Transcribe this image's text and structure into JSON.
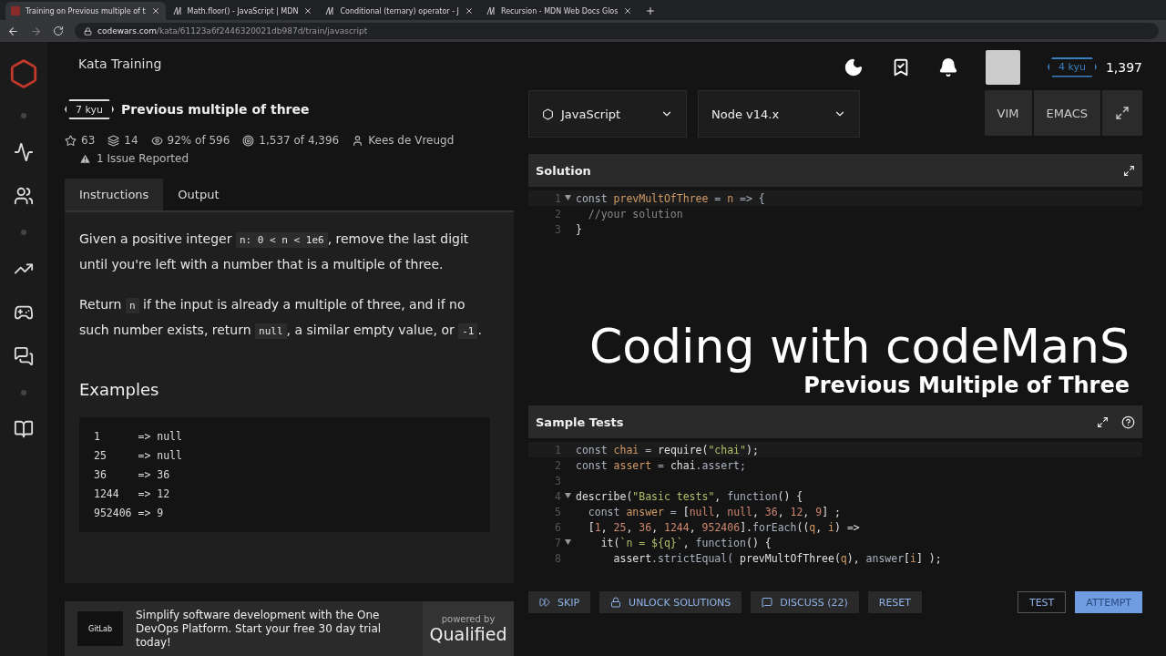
{
  "browser": {
    "tabs": [
      {
        "title": "Training on Previous multiple of t",
        "selected": true
      },
      {
        "title": "Math.floor() - JavaScript | MDN",
        "selected": false
      },
      {
        "title": "Conditional (ternary) operator - J",
        "selected": false
      },
      {
        "title": "Recursion - MDN Web Docs Glos",
        "selected": false
      }
    ],
    "url": {
      "host": "codewars.com",
      "path": "/kata/61123a6f2446320021db987d/train/javascript"
    }
  },
  "header": {
    "title": "Kata Training",
    "rank": "4 kyu",
    "honor": "1,397"
  },
  "kata": {
    "rank": "7 kyu",
    "title": "Previous multiple of three",
    "stats": [
      {
        "kind": "star",
        "text": "63"
      },
      {
        "kind": "collections",
        "text": "14"
      },
      {
        "kind": "satisfaction",
        "text": "92% of 596"
      },
      {
        "kind": "completed",
        "text": "1,537 of 4,396"
      },
      {
        "kind": "author",
        "text": "Kees de Vreugd"
      }
    ],
    "issue": "1 Issue Reported"
  },
  "tabs": [
    {
      "label": "Instructions",
      "selected": true
    },
    {
      "label": "Output",
      "selected": false
    }
  ],
  "instructions": {
    "paragraphs": [
      [
        {
          "kind": "text",
          "text": "Given a positive integer "
        },
        {
          "kind": "code",
          "text": "n: 0 < n < 1e6"
        },
        {
          "kind": "text",
          "text": ", remove the last digit until you're left with a number that is a multiple of three."
        }
      ],
      [
        {
          "kind": "text",
          "text": "Return "
        },
        {
          "kind": "code",
          "text": "n"
        },
        {
          "kind": "text",
          "text": " if the input is already a multiple of three, and if no such number exists, return "
        },
        {
          "kind": "code",
          "text": "null"
        },
        {
          "kind": "text",
          "text": ", a similar empty value, or "
        },
        {
          "kind": "code",
          "text": "-1"
        },
        {
          "kind": "text",
          "text": "."
        }
      ]
    ],
    "heading": "Examples",
    "examples": [
      "1      => null",
      "25     => null",
      "36     => 36",
      "1244   => 12",
      "952406 => 9"
    ]
  },
  "ad": {
    "logo": "GitLab",
    "text": "Simplify software development with the One DevOps Platform. Start your free 30 day trial today!",
    "powered": "powered by",
    "brand": "Qualified"
  },
  "toolbar": {
    "language": "JavaScript",
    "version": "Node v14.x",
    "modes": [
      "VIM",
      "EMACS"
    ]
  },
  "solution": {
    "title": "Solution",
    "lines": [
      {
        "number": "1",
        "fold": true,
        "tokens": [
          {
            "kind": "kw",
            "text": "const "
          },
          {
            "kind": "var",
            "text": "prevMultOfThree"
          },
          {
            "kind": "kw",
            "text": " = "
          },
          {
            "kind": "var",
            "text": "n"
          },
          {
            "kind": "kw",
            "text": " => {"
          }
        ]
      },
      {
        "number": "2",
        "fold": false,
        "tokens": [
          {
            "kind": "comment",
            "text": "  //your solution"
          }
        ]
      },
      {
        "number": "3",
        "fold": false,
        "tokens": [
          {
            "kind": "plain",
            "text": "}"
          }
        ]
      }
    ]
  },
  "overlay": {
    "title": "Coding with codeManS",
    "subtitle": "Previous Multiple of Three"
  },
  "tests": {
    "title": "Sample Tests",
    "lines": [
      {
        "number": "1",
        "fold": false,
        "tokens": [
          {
            "kind": "kw",
            "text": "const "
          },
          {
            "kind": "var",
            "text": "chai"
          },
          {
            "kind": "kw",
            "text": " = "
          },
          {
            "kind": "plain",
            "text": "require("
          },
          {
            "kind": "str",
            "text": "\"chai\""
          },
          {
            "kind": "plain",
            "text": ");"
          }
        ]
      },
      {
        "number": "2",
        "fold": false,
        "tokens": [
          {
            "kind": "kw",
            "text": "const "
          },
          {
            "kind": "var",
            "text": "assert"
          },
          {
            "kind": "kw",
            "text": " = "
          },
          {
            "kind": "plain",
            "text": "chai"
          },
          {
            "kind": "kw",
            "text": ".assert;"
          }
        ]
      },
      {
        "number": "3",
        "fold": false
      },
      {
        "number": "4",
        "fold": true,
        "tokens": [
          {
            "kind": "plain",
            "text": "describe("
          },
          {
            "kind": "str",
            "text": "\"Basic tests\""
          },
          {
            "kind": "plain",
            "text": ", "
          },
          {
            "kind": "kw",
            "text": "function"
          },
          {
            "kind": "plain",
            "text": "() {"
          }
        ]
      },
      {
        "number": "5",
        "fold": false,
        "tokens": [
          {
            "kind": "kw",
            "text": "  const "
          },
          {
            "kind": "var",
            "text": "answer"
          },
          {
            "kind": "kw",
            "text": " = "
          },
          {
            "kind": "plain",
            "text": "["
          },
          {
            "kind": "num",
            "text": "null"
          },
          {
            "kind": "plain",
            "text": ", "
          },
          {
            "kind": "num",
            "text": "null"
          },
          {
            "kind": "plain",
            "text": ", "
          },
          {
            "kind": "num",
            "text": "36"
          },
          {
            "kind": "plain",
            "text": ", "
          },
          {
            "kind": "num",
            "text": "12"
          },
          {
            "kind": "plain",
            "text": ", "
          },
          {
            "kind": "num",
            "text": "9"
          },
          {
            "kind": "plain",
            "text": "] ;"
          }
        ]
      },
      {
        "number": "6",
        "fold": false,
        "tokens": [
          {
            "kind": "plain",
            "text": "  ["
          },
          {
            "kind": "num",
            "text": "1"
          },
          {
            "kind": "plain",
            "text": ", "
          },
          {
            "kind": "num",
            "text": "25"
          },
          {
            "kind": "plain",
            "text": ", "
          },
          {
            "kind": "num",
            "text": "36"
          },
          {
            "kind": "plain",
            "text": ", "
          },
          {
            "kind": "num",
            "text": "1244"
          },
          {
            "kind": "plain",
            "text": ", "
          },
          {
            "kind": "num",
            "text": "952406"
          },
          {
            "kind": "plain",
            "text": "]."
          },
          {
            "kind": "kw",
            "text": "forEach"
          },
          {
            "kind": "plain",
            "text": "(("
          },
          {
            "kind": "var",
            "text": "q"
          },
          {
            "kind": "plain",
            "text": ", "
          },
          {
            "kind": "var",
            "text": "i"
          },
          {
            "kind": "plain",
            "text": ") =>"
          }
        ]
      },
      {
        "number": "7",
        "fold": true,
        "tokens": [
          {
            "kind": "plain",
            "text": "    it("
          },
          {
            "kind": "str",
            "text": "`n = ${q}`"
          },
          {
            "kind": "plain",
            "text": ", "
          },
          {
            "kind": "kw",
            "text": "function"
          },
          {
            "kind": "plain",
            "text": "() {"
          }
        ]
      },
      {
        "number": "8",
        "fold": false,
        "tokens": [
          {
            "kind": "plain",
            "text": "      assert"
          },
          {
            "kind": "kw",
            "text": ".strictEqual( "
          },
          {
            "kind": "plain",
            "text": "prevMultOfThree("
          },
          {
            "kind": "var",
            "text": "q"
          },
          {
            "kind": "plain",
            "text": "), "
          },
          {
            "kind": "kw",
            "text": "answer"
          },
          {
            "kind": "plain",
            "text": "["
          },
          {
            "kind": "var",
            "text": "i"
          },
          {
            "kind": "plain",
            "text": "] );"
          }
        ]
      }
    ]
  },
  "actions": [
    {
      "kind": "skip",
      "label": "SKIP"
    },
    {
      "kind": "unlock",
      "label": "UNLOCK SOLUTIONS"
    },
    {
      "kind": "discuss",
      "label": "DISCUSS (22)"
    },
    {
      "kind": "reset",
      "label": "RESET"
    },
    {
      "kind": "test",
      "label": "TEST"
    },
    {
      "kind": "attempt",
      "label": "ATTEMPT"
    }
  ]
}
